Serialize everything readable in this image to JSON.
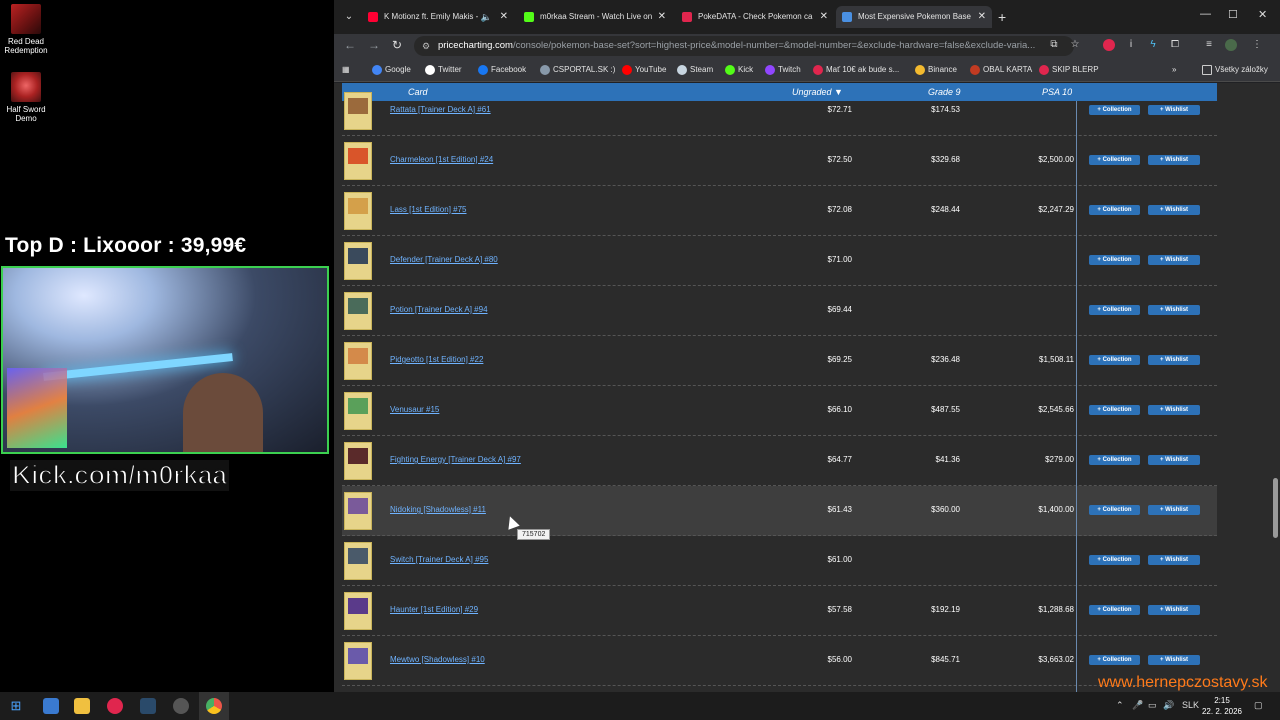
{
  "desktop": {
    "icons": [
      {
        "label": "Red Dead Redemption"
      },
      {
        "label": "Half Sword Demo"
      }
    ],
    "top_donor": "Top D : Lixooor : 39,99€",
    "kick_handle": "Kick.com/m0rkaa"
  },
  "browser": {
    "tabs": [
      {
        "title": "K Motionz ft. Emily Makis -"
      },
      {
        "title": "m0rkaa Stream - Watch Live on"
      },
      {
        "title": "PokeDATA - Check Pokemon ca"
      },
      {
        "title": "Most Expensive Pokemon Base"
      }
    ],
    "omnibox": {
      "host": "pricecharting.com",
      "path": "/console/pokemon-base-set?sort=highest-price&model-number=&model-number=&exclude-hardware=false&exclude-varia..."
    },
    "bookmarks": [
      {
        "label": "Google",
        "color": "#4285f4"
      },
      {
        "label": "Twitter",
        "color": "#ffffff"
      },
      {
        "label": "Facebook",
        "color": "#1877f2"
      },
      {
        "label": "CSPORTAL.SK :)",
        "color": "#8899aa"
      },
      {
        "label": "YouTube",
        "color": "#ff0000"
      },
      {
        "label": "Steam",
        "color": "#c7d5e0"
      },
      {
        "label": "Kick",
        "color": "#53fc18"
      },
      {
        "label": "Twitch",
        "color": "#9146ff"
      },
      {
        "label": "Mať 10€ ak bude s...",
        "color": "#e0264e"
      },
      {
        "label": "Binance",
        "color": "#f3ba2f"
      },
      {
        "label": "OBAL KARTA",
        "color": "#c23b22"
      },
      {
        "label": "SKIP BLERP",
        "color": "#e0264e"
      }
    ],
    "all_bookmarks": "Všetky záložky"
  },
  "table": {
    "headers": {
      "card": "Card",
      "ungraded": "Ungraded ▼",
      "grade9": "Grade 9",
      "psa10": "PSA 10"
    },
    "collection_label": "+ Collection",
    "wishlist_label": "+ Wishlist",
    "rows": [
      {
        "name": "Rattata [Trainer Deck A] #61",
        "ungraded": "$72.71",
        "grade9": "$174.53",
        "psa10": "",
        "art": "#9b6a3c"
      },
      {
        "name": "Charmeleon [1st Edition] #24",
        "ungraded": "$72.50",
        "grade9": "$329.68",
        "psa10": "$2,500.00",
        "art": "#d9552a"
      },
      {
        "name": "Lass [1st Edition] #75",
        "ungraded": "$72.08",
        "grade9": "$248.44",
        "psa10": "$2,247.29",
        "art": "#d4a04a"
      },
      {
        "name": "Defender [Trainer Deck A] #80",
        "ungraded": "$71.00",
        "grade9": "",
        "psa10": "",
        "art": "#3a4a5c"
      },
      {
        "name": "Potion [Trainer Deck A] #94",
        "ungraded": "$69.44",
        "grade9": "",
        "psa10": "",
        "art": "#4a6b5a"
      },
      {
        "name": "Pidgeotto [1st Edition] #22",
        "ungraded": "$69.25",
        "grade9": "$236.48",
        "psa10": "$1,508.11",
        "art": "#d48a4a"
      },
      {
        "name": "Venusaur #15",
        "ungraded": "$66.10",
        "grade9": "$487.55",
        "psa10": "$2,545.66",
        "art": "#5aa05a"
      },
      {
        "name": "Fighting Energy [Trainer Deck A] #97",
        "ungraded": "$64.77",
        "grade9": "$41.36",
        "psa10": "$279.00",
        "art": "#5a2a2a"
      },
      {
        "name": "Nidoking [Shadowless] #11",
        "ungraded": "$61.43",
        "grade9": "$360.00",
        "psa10": "$1,400.00",
        "art": "#7a5a9a"
      },
      {
        "name": "Switch [Trainer Deck A] #95",
        "ungraded": "$61.00",
        "grade9": "",
        "psa10": "",
        "art": "#4a5a6a"
      },
      {
        "name": "Haunter [1st Edition] #29",
        "ungraded": "$57.58",
        "grade9": "$192.19",
        "psa10": "$1,288.68",
        "art": "#5a3a8a"
      },
      {
        "name": "Mewtwo [Shadowless] #10",
        "ungraded": "$56.00",
        "grade9": "$845.71",
        "psa10": "$3,663.02",
        "art": "#6a5aaa"
      }
    ],
    "tooltip": "715702"
  },
  "watermark": "www.hernepczostavy.sk",
  "taskbar": {
    "lang": "SLK",
    "time": "2:15",
    "date": "22. 2. 2026"
  }
}
